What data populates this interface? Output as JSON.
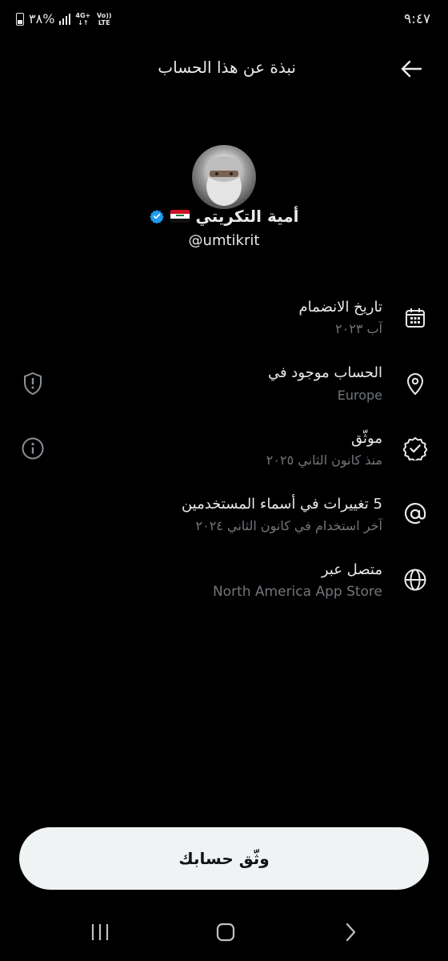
{
  "status_bar": {
    "time": "٩:٤٧",
    "battery": "٣٨%",
    "network": "4G+",
    "volte": "Vo)) LTE"
  },
  "header": {
    "title": "نبذة عن هذا الحساب",
    "back_icon": "arrow-left-icon"
  },
  "profile": {
    "name": "أمية التكريتي",
    "handle": "@umtikrit",
    "flag": "iraq-flag",
    "verified_color": "#1d9bf0"
  },
  "rows": [
    {
      "title": "تاريخ الانضمام",
      "subtitle": "آب ٢٠٢٣",
      "icon": "calendar-icon"
    },
    {
      "title": "الحساب موجود في",
      "subtitle": "Europe",
      "icon": "location-pin-icon",
      "side_icon": "shield-alert-icon"
    },
    {
      "title": "موثّق",
      "subtitle": "منذ كانون الثاني ٢٠٢٥",
      "icon": "verified-badge-icon",
      "side_icon": "info-icon"
    },
    {
      "title": "5 تغييرات في أسماء المستخدمين",
      "subtitle": "آخر استخدام في كانون الثاني ٢٠٢٤",
      "icon": "at-sign-icon"
    },
    {
      "title": "متصل عبر",
      "subtitle": "North America App Store",
      "icon": "globe-icon"
    }
  ],
  "verify_button": {
    "label": "وثّق حسابك"
  },
  "nav_bar": {
    "recent": "recent-apps-icon",
    "home": "home-icon",
    "back": "back-chevron-icon"
  }
}
